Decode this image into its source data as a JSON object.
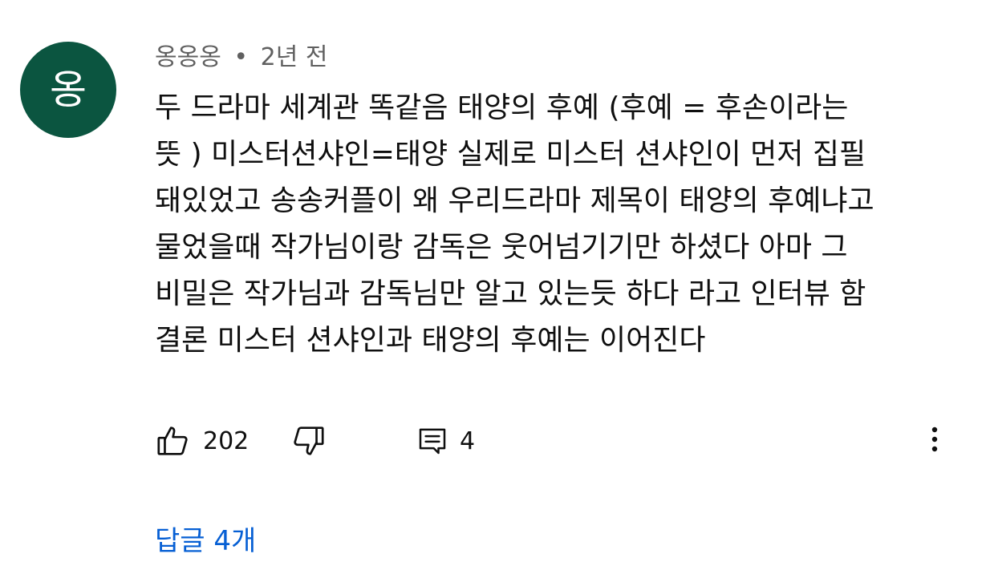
{
  "comment": {
    "avatar_letter": "옹",
    "avatar_color": "#0b5540",
    "author": "옹옹옹",
    "separator": "•",
    "time": "2년 전",
    "text_lines": [
      "두 드라마 세계관 똑같음 태양의 후예 (후예 = 후손이라는",
      "뜻 )  미스터션샤인=태양 실제로 미스터 션샤인이 먼저 집필",
      "돼있었고 송송커플이 왜 우리드라마 제목이 태양의 후예냐고",
      "물었을때 작가님이랑 감독은 웃어넘기기만 하셨다 아마 그",
      "비밀은 작가님과 감독님만 알고 있는듯 하다 라고 인터뷰 함",
      "결론 미스터 션샤인과 태양의 후예는 이어진다"
    ],
    "likes": "202",
    "replies_count_icon_label": "4",
    "replies_link": "답글 4개",
    "icons": {
      "like": "thumbs-up-icon",
      "dislike": "thumbs-down-icon",
      "reply": "comment-icon",
      "more": "more-vertical-icon"
    },
    "link_color": "#065fd4"
  }
}
